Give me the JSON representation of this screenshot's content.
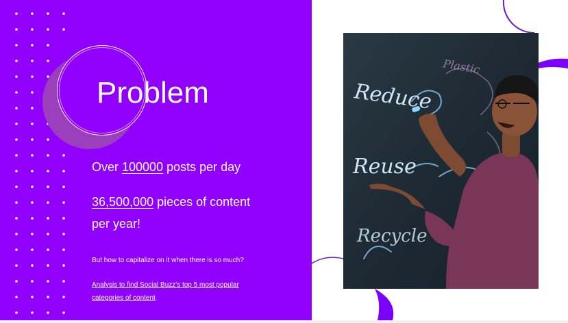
{
  "slide": {
    "title": "Problem",
    "stat_line_1": {
      "prefix": "Over ",
      "highlight": "100000",
      "suffix": " posts per day"
    },
    "stat_line_2": {
      "highlight": "36,500,000",
      "suffix": " pieces of content per year!"
    },
    "question": "But how to capitalize on it when there is so much?",
    "link_text": "Analysis to find Social Buzz's top 5 most popular categories of content",
    "chalkboard_words": [
      "Reduce",
      "Reuse",
      "Recycle",
      "Plastic"
    ]
  },
  "colors": {
    "panel": "#9100ff",
    "accent_circle": "#9c3fbd",
    "right_bg": "#ffffff",
    "deco_arc": "#6a1bd6"
  }
}
